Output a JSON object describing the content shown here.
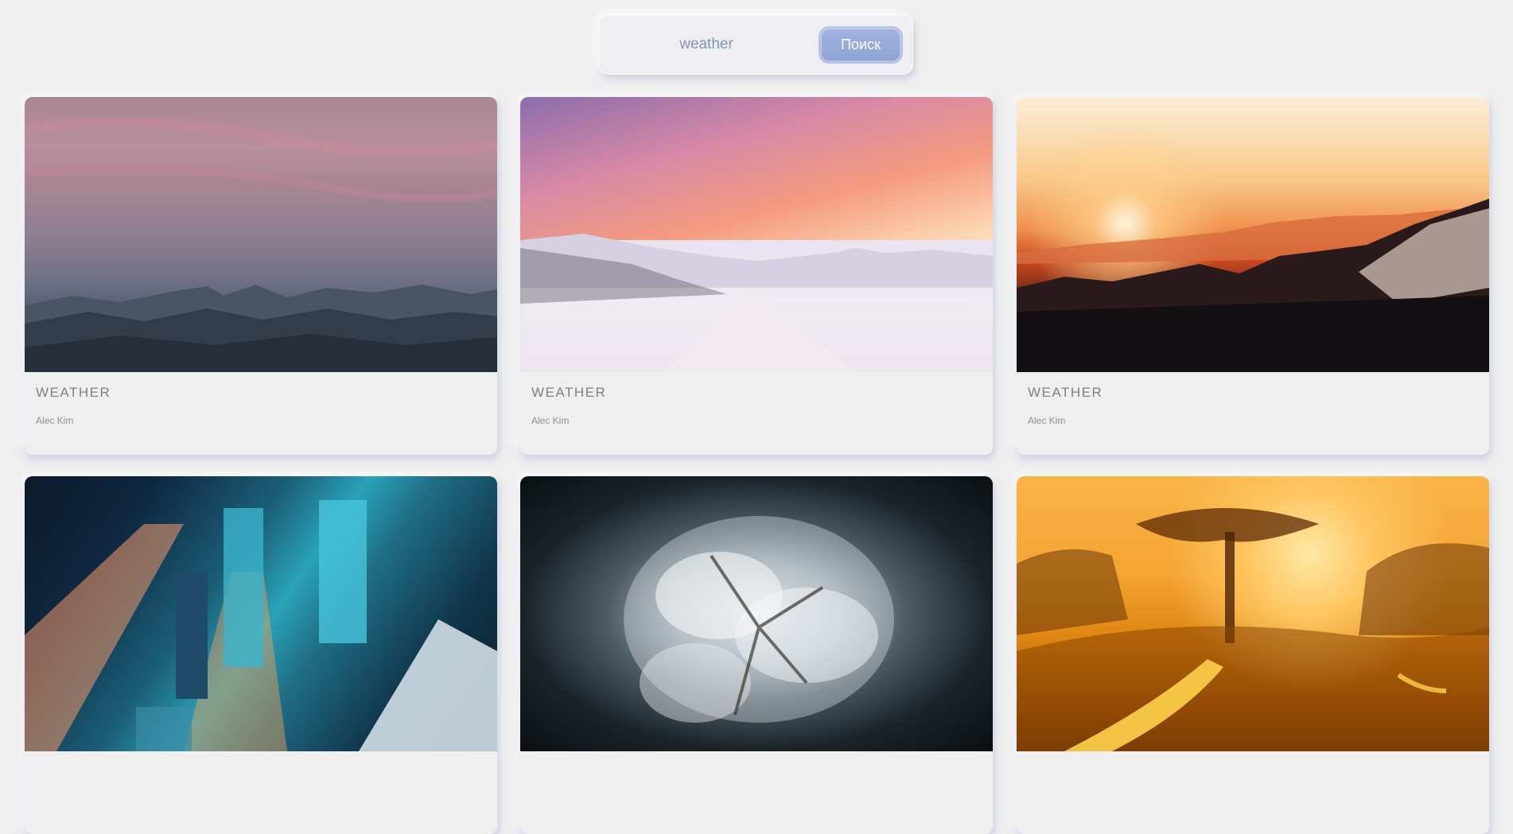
{
  "search": {
    "value": "weather",
    "button_label": "Поиск"
  },
  "cards": [
    {
      "title": "WEATHER",
      "author": "Alec Kim",
      "image": "dusky-mountains-photo"
    },
    {
      "title": "WEATHER",
      "author": "Alec Kim",
      "image": "snowy-road-sunset-photo"
    },
    {
      "title": "WEATHER",
      "author": "Alec Kim",
      "image": "sunset-forest-photo"
    },
    {
      "title": "",
      "author": "",
      "image": "city-night-aerial-photo"
    },
    {
      "title": "",
      "author": "",
      "image": "snowy-pine-photo"
    },
    {
      "title": "",
      "author": "",
      "image": "golden-savanna-photo"
    }
  ],
  "colors": {
    "background": "#efeff0",
    "accent": "#95a7d8",
    "text_muted": "#7e8088"
  }
}
